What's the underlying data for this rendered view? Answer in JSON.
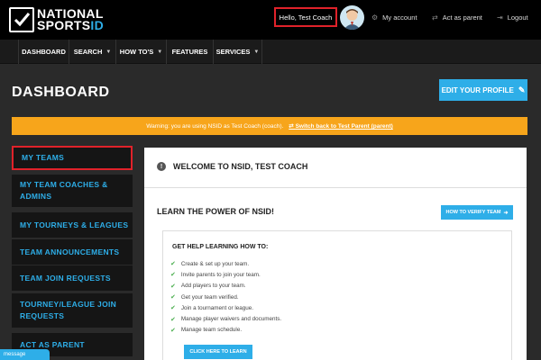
{
  "header": {
    "logo_line1": "NATIONAL",
    "logo_line2": "SPORTS",
    "logo_accent": "ID",
    "hello": "Hello, Test Coach",
    "my_account": "My account",
    "act_as_parent": "Act as parent",
    "logout": "Logout"
  },
  "nav": {
    "items": [
      {
        "label": "DASHBOARD"
      },
      {
        "label": "SEARCH"
      },
      {
        "label": "HOW TO'S"
      },
      {
        "label": "FEATURES"
      },
      {
        "label": "SERVICES"
      }
    ]
  },
  "page": {
    "title": "DASHBOARD",
    "edit_profile": "EDIT YOUR PROFILE"
  },
  "warning": {
    "text": "Warning: you are using NSID as Test Coach (coach).",
    "switch": "Switch back to Test Parent (parent)"
  },
  "sidebar": {
    "items": [
      {
        "label": "MY TEAMS"
      },
      {
        "label": "MY TEAM COACHES & ADMINS"
      },
      {
        "label": "MY TOURNEYS & LEAGUES"
      },
      {
        "label": "TEAM ANNOUNCEMENTS"
      },
      {
        "label": "TEAM JOIN REQUESTS"
      },
      {
        "label": "TOURNEY/LEAGUE JOIN REQUESTS"
      },
      {
        "label": "ACT AS PARENT"
      }
    ]
  },
  "main": {
    "welcome": "WELCOME TO NSID, TEST COACH",
    "learn_title": "LEARN THE POWER OF NSID!",
    "verify_button": "HOW TO VERIFY TEAM",
    "help_title": "GET HELP LEARNING HOW TO:",
    "help_items": [
      "Create & set up your team.",
      "Invite parents to join your team.",
      "Add players to your team.",
      "Get your team verified.",
      "Join a tournament or league.",
      "Manage player waivers and documents.",
      "Manage team schedule."
    ],
    "learn_button": "CLICK HERE TO LEARN"
  },
  "message_tab": "message",
  "colors": {
    "accent": "#2eaee8",
    "warning": "#f7a51b",
    "highlight": "#e0222a"
  }
}
